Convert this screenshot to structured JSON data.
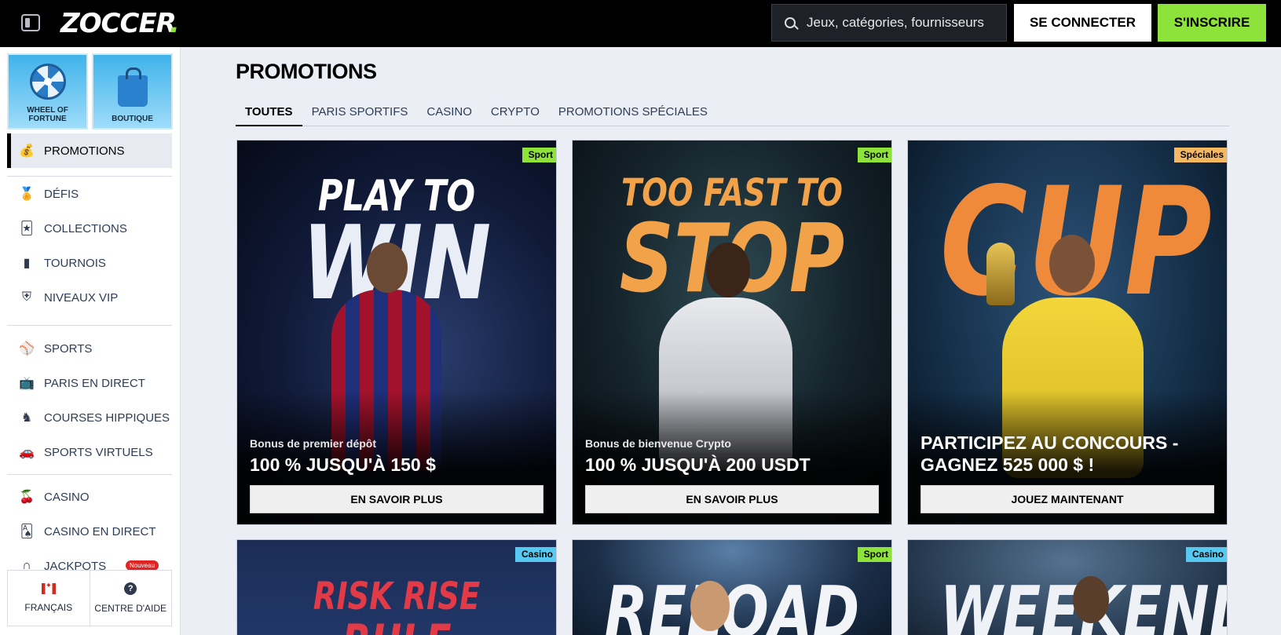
{
  "header": {
    "logo_text": "ZOCCER",
    "search_placeholder": "Jeux, catégories, fournisseurs",
    "login_label": "SE CONNECTER",
    "signup_label": "S'INSCRIRE",
    "accent_color": "#8ee33a"
  },
  "sidebar": {
    "tiles": [
      {
        "label": "WHEEL OF FORTUNE",
        "icon": "wheel-icon"
      },
      {
        "label": "BOUTIQUE",
        "icon": "shopping-bag-icon"
      }
    ],
    "items": [
      {
        "label": "PROMOTIONS",
        "icon": "money-bag-icon",
        "active": true
      },
      {
        "label": "DÉFIS",
        "icon": "medal-icon"
      },
      {
        "label": "COLLECTIONS",
        "icon": "cards-icon"
      },
      {
        "label": "TOURNOIS",
        "icon": "podium-icon"
      },
      {
        "label": "NIVEAUX VIP",
        "icon": "shield-icon"
      },
      {
        "label": "SPORTS",
        "icon": "ball-icon"
      },
      {
        "label": "PARIS EN DIRECT",
        "icon": "live-tv-icon"
      },
      {
        "label": "COURSES HIPPIQUES",
        "icon": "horse-icon"
      },
      {
        "label": "SPORTS VIRTUELS",
        "icon": "virtual-car-icon"
      },
      {
        "label": "CASINO",
        "icon": "cherries-icon"
      },
      {
        "label": "CASINO EN DIRECT",
        "icon": "live-cards-icon"
      },
      {
        "label": "JACKPOTS",
        "icon": "horseshoe-icon",
        "badge": "Nouveau"
      }
    ],
    "footer": {
      "language_label": "FRANÇAIS",
      "help_label": "CENTRE D'AIDE"
    }
  },
  "main": {
    "title": "PROMOTIONS",
    "tabs": [
      {
        "label": "TOUTES",
        "active": true
      },
      {
        "label": "PARIS SPORTIFS"
      },
      {
        "label": "CASINO"
      },
      {
        "label": "CRYPTO"
      },
      {
        "label": "PROMOTIONS SPÉCIALES"
      }
    ],
    "cards": [
      {
        "tag": "Sport",
        "art_text_1": "PLAY TO",
        "art_text_2": "WIN",
        "subtitle": "Bonus de premier dépôt",
        "title": "100 % JUSQU'À 150 $",
        "button": "EN SAVOIR PLUS"
      },
      {
        "tag": "Sport",
        "art_text_1": "TOO FAST TO",
        "art_text_2": "STOP",
        "subtitle": "Bonus de bienvenue Crypto",
        "title": "100 % JUSQU'À 200 USDT",
        "button": "EN SAVOIR PLUS"
      },
      {
        "tag": "Spéciales",
        "art_text_1": "",
        "art_text_2": "CUP",
        "subtitle": "",
        "title": "PARTICIPEZ AU CONCOURS - GAGNEZ 525 000 $ !",
        "button": "JOUEZ MAINTENANT"
      },
      {
        "tag": "Casino",
        "art_text_1": "RISK RISE",
        "art_text_2": "RULE"
      },
      {
        "tag": "Sport",
        "art_text_1": "",
        "art_text_2": "RELOAD"
      },
      {
        "tag": "Casino",
        "art_text_1": "",
        "art_text_2": "WEEKEND"
      }
    ]
  }
}
